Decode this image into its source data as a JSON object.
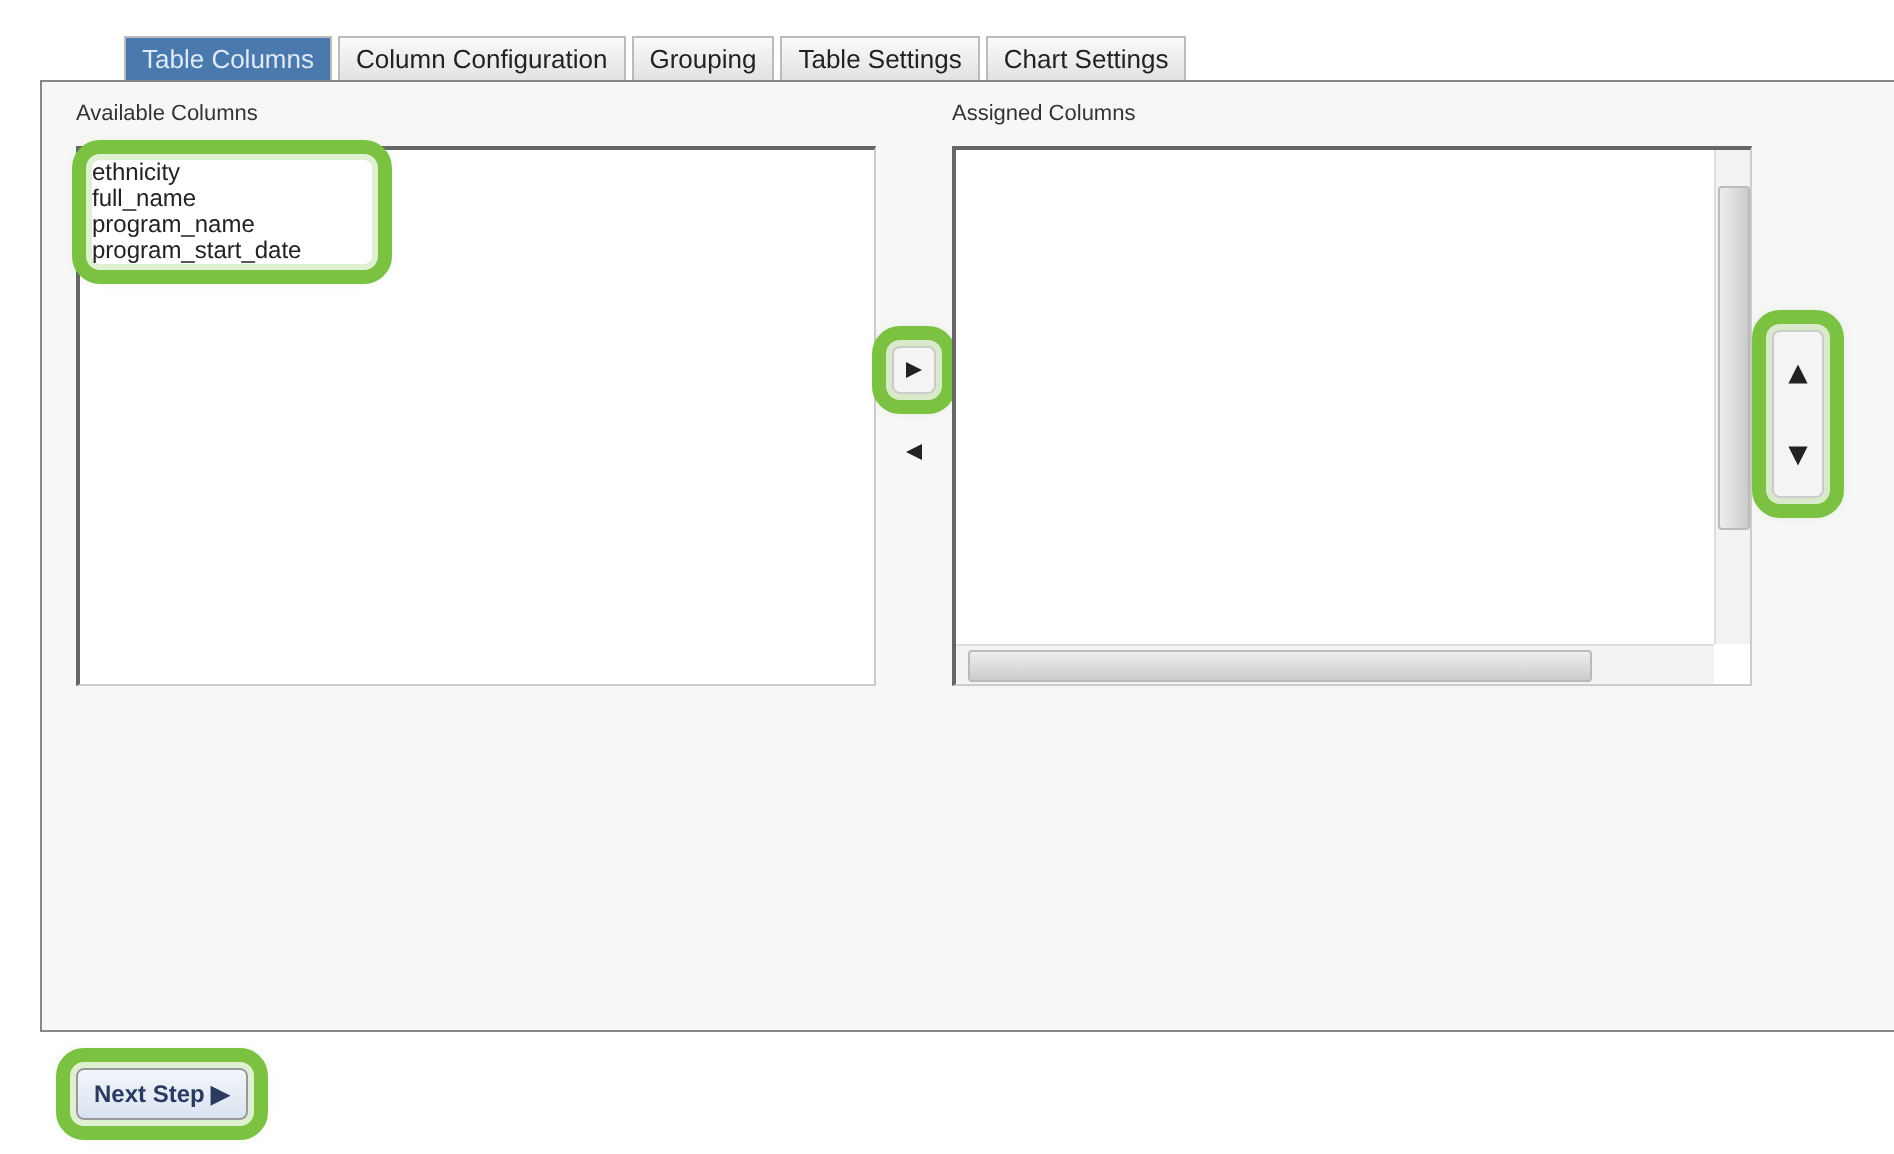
{
  "tabs": [
    {
      "label": "Table Columns",
      "selected": true
    },
    {
      "label": "Column Configuration",
      "selected": false
    },
    {
      "label": "Grouping",
      "selected": false
    },
    {
      "label": "Table Settings",
      "selected": false
    },
    {
      "label": "Chart Settings",
      "selected": false
    }
  ],
  "available_columns": {
    "label": "Available Columns",
    "highlighted": true,
    "items": [
      "ethnicity",
      "full_name",
      "program_name",
      "program_start_date"
    ]
  },
  "move_buttons": {
    "add_highlighted": true,
    "remove_highlighted": false
  },
  "assigned_columns": {
    "label": "Assigned Columns"
  },
  "order_buttons": {
    "highlighted": true
  },
  "next_button": {
    "label": "Next Step ▶",
    "highlighted": true
  }
}
